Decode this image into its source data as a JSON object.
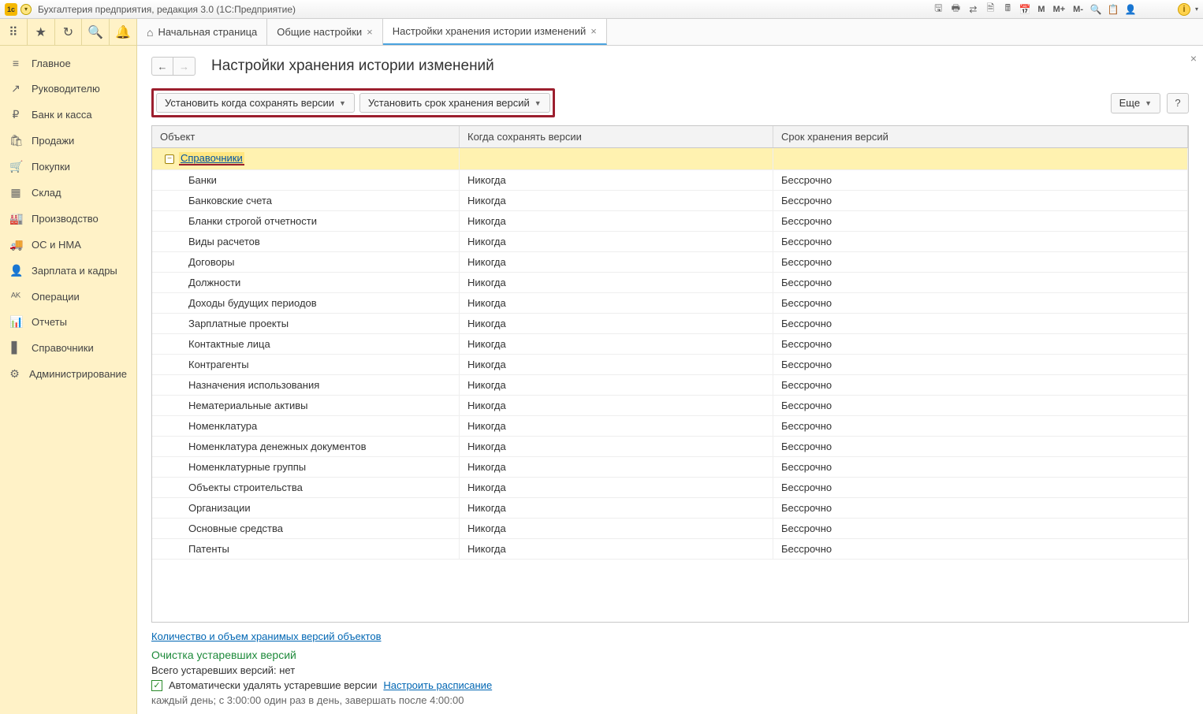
{
  "titlebar": {
    "title": "Бухгалтерия предприятия, редакция 3.0  (1С:Предприятие)",
    "right_text_icons": [
      "M",
      "M+",
      "M-"
    ]
  },
  "sidebar": {
    "items": [
      {
        "icon": "≡",
        "label": "Главное"
      },
      {
        "icon": "↗",
        "label": "Руководителю"
      },
      {
        "icon": "₽",
        "label": "Банк и касса"
      },
      {
        "icon": "🛍",
        "label": "Продажи"
      },
      {
        "icon": "🛒",
        "label": "Покупки"
      },
      {
        "icon": "▦",
        "label": "Склад"
      },
      {
        "icon": "🏭",
        "label": "Производство"
      },
      {
        "icon": "🚚",
        "label": "ОС и НМА"
      },
      {
        "icon": "👤",
        "label": "Зарплата и кадры"
      },
      {
        "icon": "ᴬᴷ",
        "label": "Операции"
      },
      {
        "icon": "📊",
        "label": "Отчеты"
      },
      {
        "icon": "▋",
        "label": "Справочники"
      },
      {
        "icon": "⚙",
        "label": "Администрирование"
      }
    ]
  },
  "tabs": {
    "home": "Начальная страница",
    "t1": "Общие настройки",
    "t2": "Настройки хранения истории изменений"
  },
  "page": {
    "title": "Настройки хранения истории изменений",
    "btn_set_when": "Установить когда сохранять версии",
    "btn_set_term": "Установить срок хранения версий",
    "btn_more": "Еще"
  },
  "grid": {
    "h1": "Объект",
    "h2": "Когда сохранять версии",
    "h3": "Срок хранения версий",
    "group": "Справочники",
    "rows": [
      {
        "o": "Банки",
        "w": "Никогда",
        "t": "Бессрочно"
      },
      {
        "o": "Банковские счета",
        "w": "Никогда",
        "t": "Бессрочно"
      },
      {
        "o": "Бланки строгой отчетности",
        "w": "Никогда",
        "t": "Бессрочно"
      },
      {
        "o": "Виды расчетов",
        "w": "Никогда",
        "t": "Бессрочно"
      },
      {
        "o": "Договоры",
        "w": "Никогда",
        "t": "Бессрочно"
      },
      {
        "o": "Должности",
        "w": "Никогда",
        "t": "Бессрочно"
      },
      {
        "o": "Доходы будущих периодов",
        "w": "Никогда",
        "t": "Бессрочно"
      },
      {
        "o": "Зарплатные проекты",
        "w": "Никогда",
        "t": "Бессрочно"
      },
      {
        "o": "Контактные лица",
        "w": "Никогда",
        "t": "Бессрочно"
      },
      {
        "o": "Контрагенты",
        "w": "Никогда",
        "t": "Бессрочно"
      },
      {
        "o": "Назначения использования",
        "w": "Никогда",
        "t": "Бессрочно"
      },
      {
        "o": "Нематериальные активы",
        "w": "Никогда",
        "t": "Бессрочно"
      },
      {
        "o": "Номенклатура",
        "w": "Никогда",
        "t": "Бессрочно"
      },
      {
        "o": "Номенклатура денежных документов",
        "w": "Никогда",
        "t": "Бессрочно"
      },
      {
        "o": "Номенклатурные группы",
        "w": "Никогда",
        "t": "Бессрочно"
      },
      {
        "o": "Объекты строительства",
        "w": "Никогда",
        "t": "Бессрочно"
      },
      {
        "o": "Организации",
        "w": "Никогда",
        "t": "Бессрочно"
      },
      {
        "o": "Основные средства",
        "w": "Никогда",
        "t": "Бессрочно"
      },
      {
        "o": "Патенты",
        "w": "Никогда",
        "t": "Бессрочно"
      }
    ]
  },
  "bottom": {
    "link_count": "Количество и объем хранимых версий объектов",
    "cleanup_title": "Очистка устаревших версий",
    "total": "Всего устаревших версий: нет",
    "auto_label": "Автоматически удалять устаревшие версии",
    "schedule_link": "Настроить расписание",
    "schedule_text": "каждый день; с 3:00:00 один раз в день, завершать после 4:00:00"
  }
}
